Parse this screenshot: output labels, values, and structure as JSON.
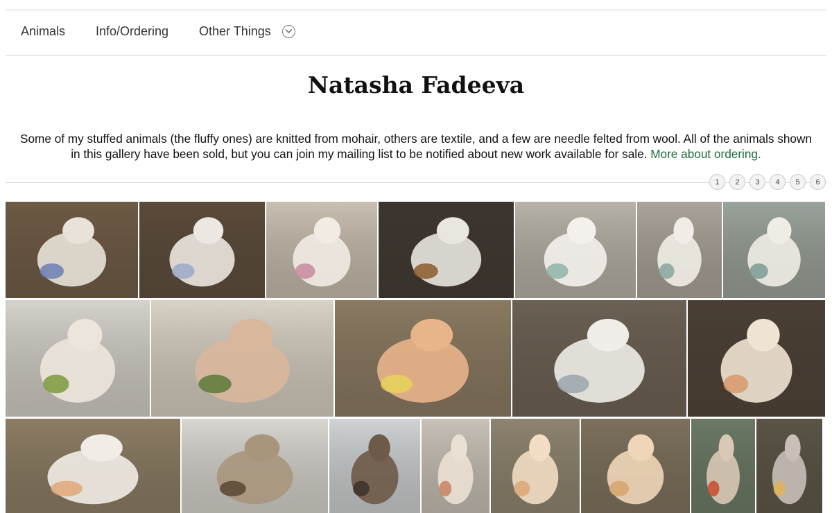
{
  "nav": {
    "items": [
      "Animals",
      "Info/Ordering",
      "Other Things"
    ]
  },
  "title": "Natasha Fadeeva",
  "intro": {
    "text": "Some of my stuffed animals (the fluffy ones) are knitted from mohair, others are textile, and a few are needle felted from wool. All of the animals shown in this gallery have been sold, but you can join my mailing list to be notified about new work available for sale.",
    "link": "More about ordering."
  },
  "pager": [
    "1",
    "2",
    "3",
    "4",
    "5",
    "6"
  ],
  "gallery": {
    "rows": [
      [
        {
          "name": "photo-mice-tea-party-1",
          "bg": "#6e5a45",
          "fg": "#e8e2d8",
          "accent": "#6b7fb3"
        },
        {
          "name": "photo-mice-tea-party-2",
          "bg": "#5a4a3a",
          "fg": "#ece7e0",
          "accent": "#9ea9c9"
        },
        {
          "name": "photo-mice-pair-scarves",
          "bg": "#c9bfb2",
          "fg": "#f1ebe4",
          "accent": "#c98aa0"
        },
        {
          "name": "photo-mouse-with-sled",
          "bg": "#3d3630",
          "fg": "#e9e5df",
          "accent": "#8b5a2b"
        },
        {
          "name": "photo-mice-on-bench-1",
          "bg": "#b8b3a9",
          "fg": "#f4f1ec",
          "accent": "#8fb3a8"
        },
        {
          "name": "photo-mice-on-bench-2",
          "bg": "#aaa49a",
          "fg": "#f1ede6",
          "accent": "#86a89d"
        },
        {
          "name": "photo-mice-floral-backdrop",
          "bg": "#9aa39c",
          "fg": "#efece6",
          "accent": "#7c9a96"
        }
      ],
      [
        {
          "name": "photo-mice-with-flowers",
          "bg": "#d5d2cc",
          "fg": "#ece5dc",
          "accent": "#7a9a3e"
        },
        {
          "name": "photo-mice-green-bench",
          "bg": "#d8d2c6",
          "fg": "#d9b79c",
          "accent": "#5d7a3a"
        },
        {
          "name": "photo-cat-with-small-animals",
          "bg": "#8a7a62",
          "fg": "#e8b48a",
          "accent": "#e8d25a"
        },
        {
          "name": "photo-white-cats-window",
          "bg": "#6b6054",
          "fg": "#f0ede8",
          "accent": "#9aa6ae"
        },
        {
          "name": "photo-fluffy-cat-lying",
          "bg": "#4a3f35",
          "fg": "#efe3d3",
          "accent": "#d99a6a"
        }
      ],
      [
        {
          "name": "photo-cats-group",
          "bg": "#8c7d64",
          "fg": "#f1ece5",
          "accent": "#e0a878"
        },
        {
          "name": "photo-sleeping-bear",
          "bg": "#d9d7d2",
          "fg": "#a8967c",
          "accent": "#5a4634"
        },
        {
          "name": "photo-bird-in-snow",
          "bg": "#cfd3d6",
          "fg": "#6d5a48",
          "accent": "#3d3128"
        },
        {
          "name": "photo-cat-with-bag",
          "bg": "#c8c2b8",
          "fg": "#ebe0d4",
          "accent": "#c98060"
        },
        {
          "name": "photo-bunny-fluffy-1",
          "bg": "#8e8470",
          "fg": "#f2dcc3",
          "accent": "#d9a874"
        },
        {
          "name": "photo-bunny-fluffy-2",
          "bg": "#7d715d",
          "fg": "#f0d6b8",
          "accent": "#d7a46e"
        },
        {
          "name": "photo-bunny-in-sweater",
          "bg": "#6a7a66",
          "fg": "#d8c8b5",
          "accent": "#c84a2a"
        },
        {
          "name": "photo-cat-standing",
          "bg": "#5a5346",
          "fg": "#c7bfb8",
          "accent": "#e2b25a"
        }
      ]
    ]
  },
  "colors": {
    "link": "#1e6b3c",
    "divider": "#d4d4d4"
  }
}
